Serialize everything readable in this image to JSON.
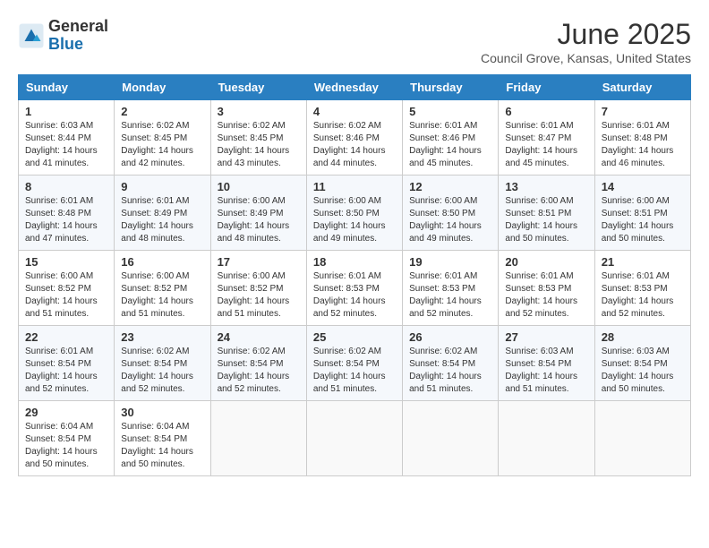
{
  "header": {
    "logo_general": "General",
    "logo_blue": "Blue",
    "month_title": "June 2025",
    "location": "Council Grove, Kansas, United States"
  },
  "calendar": {
    "days_of_week": [
      "Sunday",
      "Monday",
      "Tuesday",
      "Wednesday",
      "Thursday",
      "Friday",
      "Saturday"
    ],
    "weeks": [
      [
        {
          "day": "1",
          "sunrise": "6:03 AM",
          "sunset": "8:44 PM",
          "daylight": "14 hours and 41 minutes."
        },
        {
          "day": "2",
          "sunrise": "6:02 AM",
          "sunset": "8:45 PM",
          "daylight": "14 hours and 42 minutes."
        },
        {
          "day": "3",
          "sunrise": "6:02 AM",
          "sunset": "8:45 PM",
          "daylight": "14 hours and 43 minutes."
        },
        {
          "day": "4",
          "sunrise": "6:02 AM",
          "sunset": "8:46 PM",
          "daylight": "14 hours and 44 minutes."
        },
        {
          "day": "5",
          "sunrise": "6:01 AM",
          "sunset": "8:46 PM",
          "daylight": "14 hours and 45 minutes."
        },
        {
          "day": "6",
          "sunrise": "6:01 AM",
          "sunset": "8:47 PM",
          "daylight": "14 hours and 45 minutes."
        },
        {
          "day": "7",
          "sunrise": "6:01 AM",
          "sunset": "8:48 PM",
          "daylight": "14 hours and 46 minutes."
        }
      ],
      [
        {
          "day": "8",
          "sunrise": "6:01 AM",
          "sunset": "8:48 PM",
          "daylight": "14 hours and 47 minutes."
        },
        {
          "day": "9",
          "sunrise": "6:01 AM",
          "sunset": "8:49 PM",
          "daylight": "14 hours and 48 minutes."
        },
        {
          "day": "10",
          "sunrise": "6:00 AM",
          "sunset": "8:49 PM",
          "daylight": "14 hours and 48 minutes."
        },
        {
          "day": "11",
          "sunrise": "6:00 AM",
          "sunset": "8:50 PM",
          "daylight": "14 hours and 49 minutes."
        },
        {
          "day": "12",
          "sunrise": "6:00 AM",
          "sunset": "8:50 PM",
          "daylight": "14 hours and 49 minutes."
        },
        {
          "day": "13",
          "sunrise": "6:00 AM",
          "sunset": "8:51 PM",
          "daylight": "14 hours and 50 minutes."
        },
        {
          "day": "14",
          "sunrise": "6:00 AM",
          "sunset": "8:51 PM",
          "daylight": "14 hours and 50 minutes."
        }
      ],
      [
        {
          "day": "15",
          "sunrise": "6:00 AM",
          "sunset": "8:52 PM",
          "daylight": "14 hours and 51 minutes."
        },
        {
          "day": "16",
          "sunrise": "6:00 AM",
          "sunset": "8:52 PM",
          "daylight": "14 hours and 51 minutes."
        },
        {
          "day": "17",
          "sunrise": "6:00 AM",
          "sunset": "8:52 PM",
          "daylight": "14 hours and 51 minutes."
        },
        {
          "day": "18",
          "sunrise": "6:01 AM",
          "sunset": "8:53 PM",
          "daylight": "14 hours and 52 minutes."
        },
        {
          "day": "19",
          "sunrise": "6:01 AM",
          "sunset": "8:53 PM",
          "daylight": "14 hours and 52 minutes."
        },
        {
          "day": "20",
          "sunrise": "6:01 AM",
          "sunset": "8:53 PM",
          "daylight": "14 hours and 52 minutes."
        },
        {
          "day": "21",
          "sunrise": "6:01 AM",
          "sunset": "8:53 PM",
          "daylight": "14 hours and 52 minutes."
        }
      ],
      [
        {
          "day": "22",
          "sunrise": "6:01 AM",
          "sunset": "8:54 PM",
          "daylight": "14 hours and 52 minutes."
        },
        {
          "day": "23",
          "sunrise": "6:02 AM",
          "sunset": "8:54 PM",
          "daylight": "14 hours and 52 minutes."
        },
        {
          "day": "24",
          "sunrise": "6:02 AM",
          "sunset": "8:54 PM",
          "daylight": "14 hours and 52 minutes."
        },
        {
          "day": "25",
          "sunrise": "6:02 AM",
          "sunset": "8:54 PM",
          "daylight": "14 hours and 51 minutes."
        },
        {
          "day": "26",
          "sunrise": "6:02 AM",
          "sunset": "8:54 PM",
          "daylight": "14 hours and 51 minutes."
        },
        {
          "day": "27",
          "sunrise": "6:03 AM",
          "sunset": "8:54 PM",
          "daylight": "14 hours and 51 minutes."
        },
        {
          "day": "28",
          "sunrise": "6:03 AM",
          "sunset": "8:54 PM",
          "daylight": "14 hours and 50 minutes."
        }
      ],
      [
        {
          "day": "29",
          "sunrise": "6:04 AM",
          "sunset": "8:54 PM",
          "daylight": "14 hours and 50 minutes."
        },
        {
          "day": "30",
          "sunrise": "6:04 AM",
          "sunset": "8:54 PM",
          "daylight": "14 hours and 50 minutes."
        },
        null,
        null,
        null,
        null,
        null
      ]
    ]
  }
}
